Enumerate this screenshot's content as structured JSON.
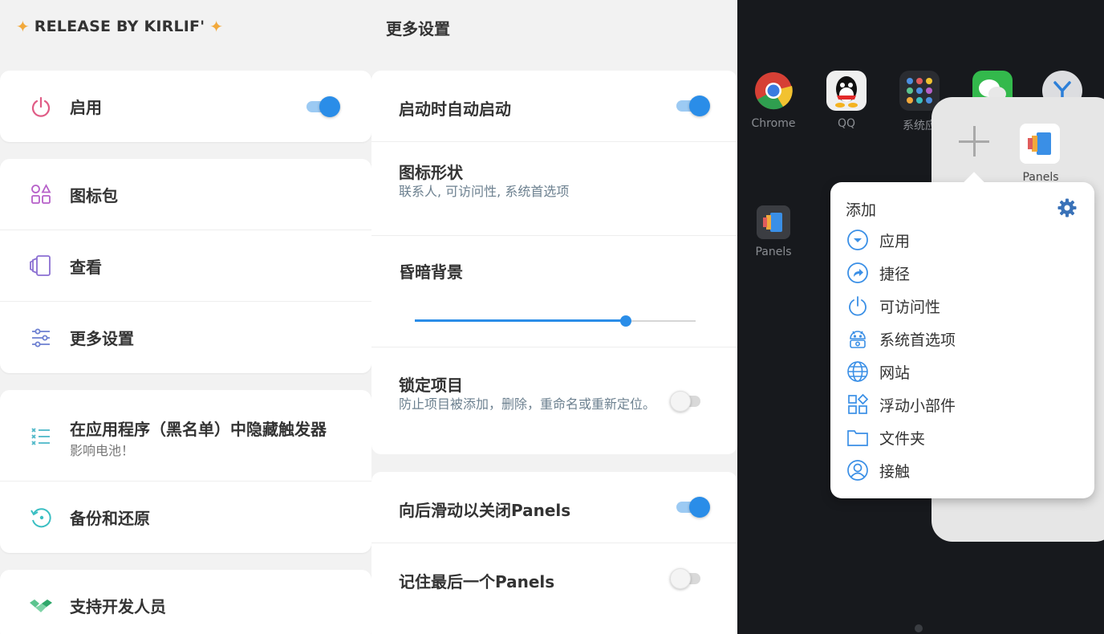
{
  "left": {
    "header": {
      "title": "RELEASE BY KIRLIF'",
      "spark": "✦"
    },
    "items": [
      {
        "label": "启用",
        "icon": "power-icon",
        "toggle": true
      },
      {
        "label": "图标包",
        "icon": "shapes-icon"
      },
      {
        "label": "查看",
        "icon": "cards-icon"
      },
      {
        "label": "更多设置",
        "icon": "sliders-icon"
      },
      {
        "label": "在应用程序（黑名单）中隐藏触发器",
        "sublabel": "影响电池！",
        "icon": "checklist-icon"
      },
      {
        "label": "备份和还原",
        "icon": "backup-icon"
      },
      {
        "label": "支持开发人员",
        "icon": "handshake-icon"
      }
    ]
  },
  "middle": {
    "title": "更多设置",
    "settings": [
      {
        "title": "启动时自动启动",
        "toggle": true
      },
      {
        "title": "图标形状",
        "subtitle": "联系人, 可访问性, 系统首选项"
      },
      {
        "title": "昏暗背景",
        "slider_value": 0.75
      },
      {
        "title": "锁定项目",
        "subtitle": "防止项目被添加，删除，重命名或重新定位。",
        "toggle": false
      },
      {
        "title": "向后滑动以关闭Panels",
        "toggle": true
      },
      {
        "title": "记住最后一个Panels",
        "toggle": false
      }
    ]
  },
  "right": {
    "apps": [
      {
        "name": "Chrome",
        "icon": "chrome-icon"
      },
      {
        "name": "QQ",
        "icon": "qq-icon"
      },
      {
        "name": "系统应",
        "icon": "system-apps-icon"
      },
      {
        "name": "",
        "icon": "wechat-icon"
      },
      {
        "name": "",
        "icon": "app-y-icon"
      },
      {
        "name": "Panels",
        "icon": "panels-icon"
      }
    ],
    "panel": {
      "item_label": "Panels"
    },
    "menu": {
      "title": "添加",
      "items": [
        {
          "label": "应用",
          "icon": "app-dropdown-icon"
        },
        {
          "label": "捷径",
          "icon": "shortcut-icon"
        },
        {
          "label": "可访问性",
          "icon": "power-icon"
        },
        {
          "label": "系统首选项",
          "icon": "android-settings-icon"
        },
        {
          "label": "网站",
          "icon": "globe-icon"
        },
        {
          "label": "浮动小部件",
          "icon": "widgets-icon"
        },
        {
          "label": "文件夹",
          "icon": "folder-icon"
        },
        {
          "label": "接触",
          "icon": "contact-icon"
        }
      ]
    }
  },
  "colors": {
    "accent": "#2a8de8",
    "track_on": "#9ccaf3",
    "spark": "#f2a93b"
  }
}
